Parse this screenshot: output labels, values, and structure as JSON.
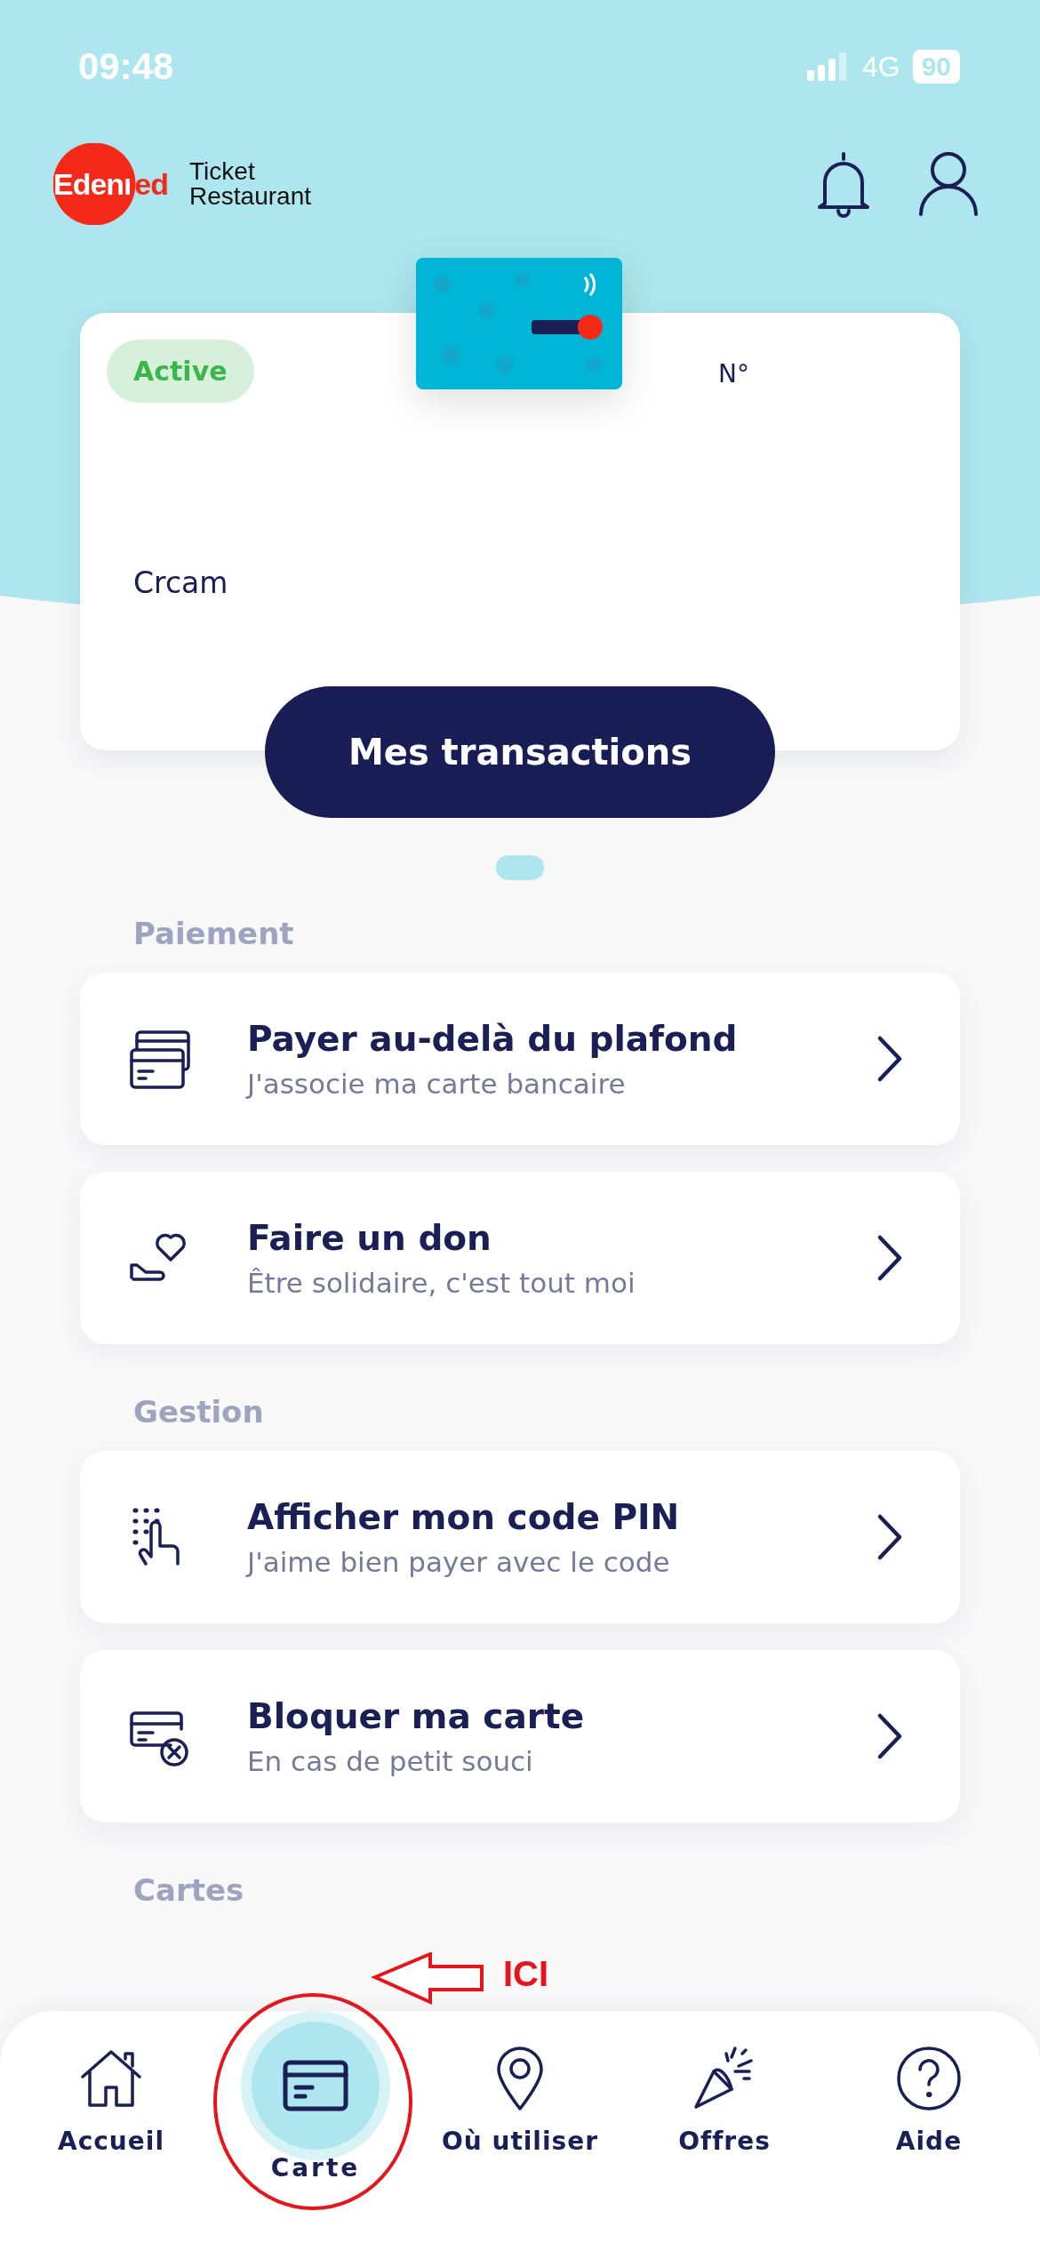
{
  "status_bar": {
    "time": "09:48",
    "network": "4G",
    "battery": "90"
  },
  "header": {
    "brand": "Edenred",
    "product_line1": "Ticket",
    "product_line2": "Restaurant"
  },
  "card": {
    "status": "Active",
    "number_label": "N°",
    "issuer": "Crcam",
    "button": "Mes transactions"
  },
  "sections": [
    {
      "title": "Paiement",
      "items": [
        {
          "title": "Payer au-delà du plafond",
          "subtitle": "J'associe ma carte bancaire"
        },
        {
          "title": "Faire un don",
          "subtitle": "Être solidaire, c'est tout moi"
        }
      ]
    },
    {
      "title": "Gestion",
      "items": [
        {
          "title": "Afficher mon code PIN",
          "subtitle": "J'aime bien payer avec le code"
        },
        {
          "title": "Bloquer ma carte",
          "subtitle": "En cas de petit souci"
        }
      ]
    },
    {
      "title": "Cartes"
    }
  ],
  "nav": [
    {
      "label": "Accueil",
      "selected": false
    },
    {
      "label": "Carte",
      "selected": true
    },
    {
      "label": "Où utiliser",
      "selected": false
    },
    {
      "label": "Offres",
      "selected": false
    },
    {
      "label": "Aide",
      "selected": false
    }
  ],
  "annotation": {
    "text": "ICI"
  }
}
